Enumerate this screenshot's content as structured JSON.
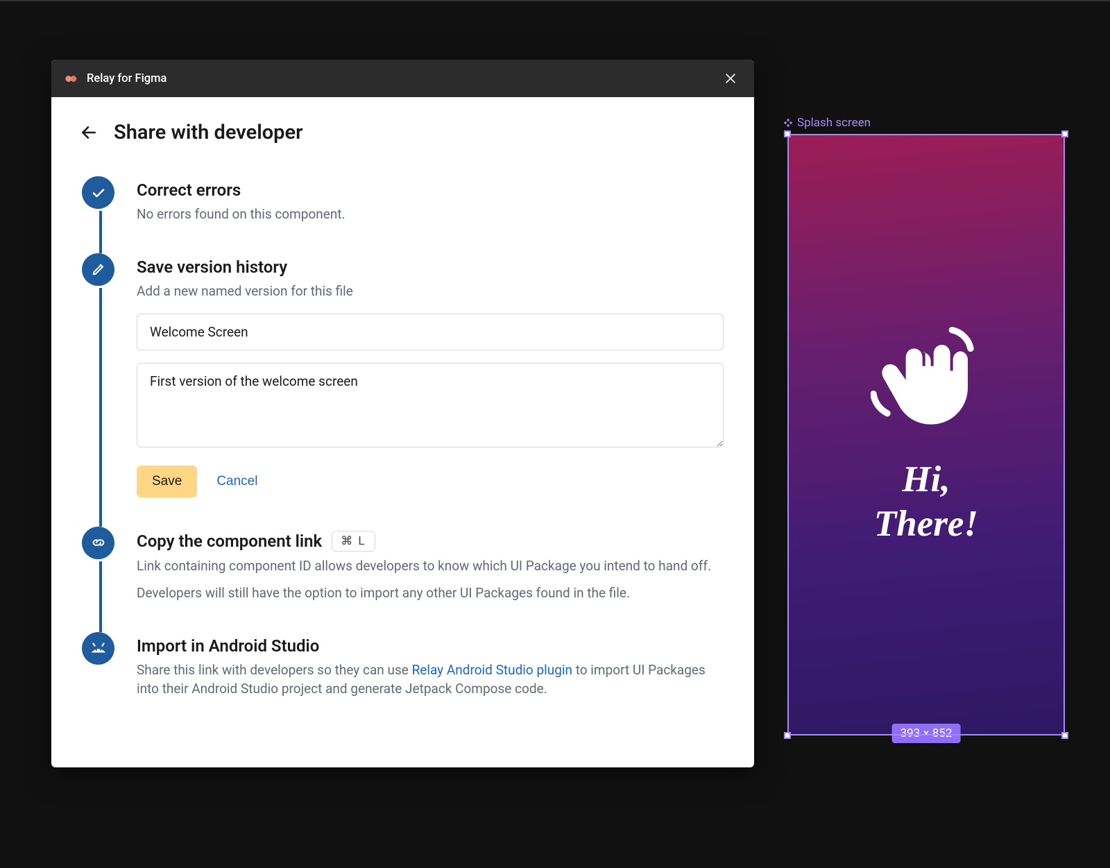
{
  "plugin": {
    "title": "Relay for Figma"
  },
  "header": {
    "title": "Share with developer"
  },
  "steps": {
    "errors": {
      "title": "Correct errors",
      "desc": "No errors found on this component."
    },
    "version": {
      "title": "Save version history",
      "desc": "Add a new named version for this file",
      "name_value": "Welcome Screen",
      "desc_value": "First version of the welcome screen",
      "save_label": "Save",
      "cancel_label": "Cancel"
    },
    "copy": {
      "title": "Copy the component link",
      "shortcut": "⌘ L",
      "desc1": "Link containing component ID allows developers to know which UI Package you intend to hand off.",
      "desc2": "Developers will still have the option to import any other UI Packages found in the file."
    },
    "import": {
      "title": "Import in Android Studio",
      "desc_prefix": "Share this link with developers so they can use ",
      "desc_link": "Relay Android Studio plugin",
      "desc_suffix": " to import UI Packages into their Android Studio project and generate Jetpack Compose code."
    }
  },
  "canvas": {
    "frame_name": "Splash screen",
    "size_label": "393 × 852",
    "greeting_line1": "Hi,",
    "greeting_line2": "There!"
  }
}
